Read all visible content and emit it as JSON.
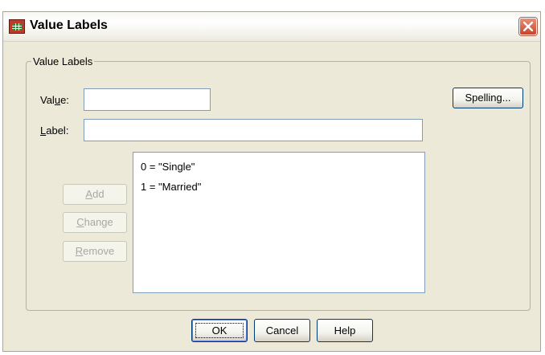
{
  "window": {
    "title": "Value Labels",
    "close_glyph": "✕"
  },
  "group": {
    "legend": "Value Labels"
  },
  "form": {
    "value_label_pre": "Val",
    "value_label_mn": "u",
    "value_label_post": "e:",
    "value_input": "",
    "label_label_mn": "L",
    "label_label_post": "abel:",
    "label_input": ""
  },
  "buttons": {
    "spelling": "Spelling...",
    "add_mn": "A",
    "add_rest": "dd",
    "change_mn": "C",
    "change_rest": "hange",
    "remove_mn": "R",
    "remove_rest": "emove",
    "ok": "OK",
    "cancel": "Cancel",
    "help": "Help"
  },
  "list": {
    "items": [
      "0 = \"Single\"",
      "1 = \"Married\""
    ]
  },
  "icons": {
    "app": "spss-data-editor-icon",
    "close": "close-icon"
  },
  "colors": {
    "dialog_bg": "#ece9d8",
    "close_button": "#c8442a",
    "button_border": "#003c74"
  }
}
